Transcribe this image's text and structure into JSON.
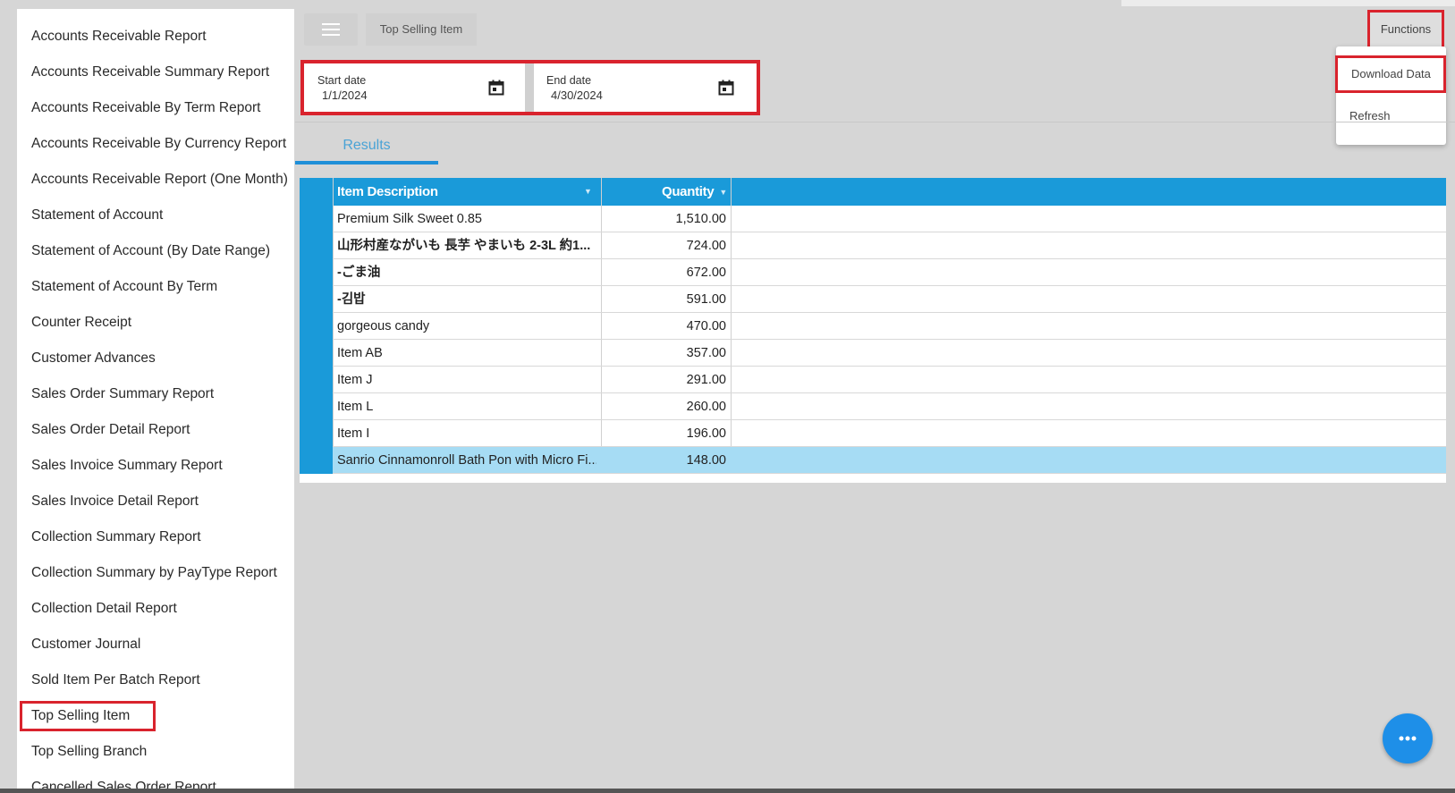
{
  "sidebar": {
    "items": [
      {
        "label": "Accounts Receivable Report"
      },
      {
        "label": "Accounts Receivable Summary Report"
      },
      {
        "label": "Accounts Receivable By Term Report"
      },
      {
        "label": "Accounts Receivable By Currency Report"
      },
      {
        "label": "Accounts Receivable Report (One Month)"
      },
      {
        "label": "Statement of Account"
      },
      {
        "label": "Statement of Account (By Date Range)"
      },
      {
        "label": "Statement of Account By Term"
      },
      {
        "label": "Counter Receipt"
      },
      {
        "label": "Customer Advances"
      },
      {
        "label": "Sales Order Summary Report"
      },
      {
        "label": "Sales Order Detail Report"
      },
      {
        "label": "Sales Invoice Summary Report"
      },
      {
        "label": "Sales Invoice Detail Report"
      },
      {
        "label": "Collection Summary Report"
      },
      {
        "label": "Collection Summary by PayType Report"
      },
      {
        "label": "Collection Detail Report"
      },
      {
        "label": "Customer Journal"
      },
      {
        "label": "Sold Item Per Batch Report"
      },
      {
        "label": "Top Selling Item"
      },
      {
        "label": "Top Selling Branch"
      },
      {
        "label": "Cancelled Sales Order Report"
      }
    ],
    "active_index": 19
  },
  "header": {
    "tab_title": "Top Selling Item",
    "functions_label": "Functions",
    "menu_icon": "hamburger-icon"
  },
  "functions_menu": {
    "download_label": "Download Data",
    "refresh_label": "Refresh"
  },
  "filters": {
    "start_date_label": "Start date",
    "start_date_value": "1/1/2024",
    "end_date_label": "End date",
    "end_date_value": "4/30/2024",
    "calendar_icon": "calendar-icon"
  },
  "results_tab": {
    "label": "Results"
  },
  "table": {
    "columns": [
      "Item Description",
      "Quantity"
    ],
    "rows": [
      {
        "description": "Premium Silk Sweet 0.85",
        "quantity": "1,510.00",
        "bold": false
      },
      {
        "description": "山形村産ながいも 長芋 やまいも 2-3L 約1...",
        "quantity": "724.00",
        "bold": true
      },
      {
        "description": "-ごま油",
        "quantity": "672.00",
        "bold": true
      },
      {
        "description": "-김밥",
        "quantity": "591.00",
        "bold": true
      },
      {
        "description": "gorgeous candy",
        "quantity": "470.00",
        "bold": false
      },
      {
        "description": "Item AB",
        "quantity": "357.00",
        "bold": false
      },
      {
        "description": "Item J",
        "quantity": "291.00",
        "bold": false
      },
      {
        "description": "Item L",
        "quantity": "260.00",
        "bold": false
      },
      {
        "description": "Item I",
        "quantity": "196.00",
        "bold": false
      },
      {
        "description": "Sanrio Cinnamonroll Bath Pon with Micro Fi...",
        "quantity": "148.00",
        "bold": false
      }
    ],
    "selected_index": 9
  },
  "fab": {
    "icon": "more-horizontal-icon"
  },
  "colors": {
    "accent": "#1a9ad9",
    "highlight": "#d9232d",
    "selected_row": "#a6dcf4",
    "background": "#d6d6d6"
  }
}
